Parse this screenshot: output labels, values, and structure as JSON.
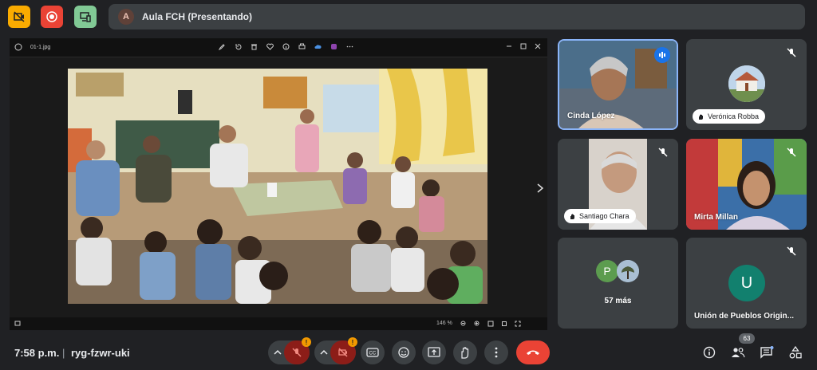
{
  "header": {
    "presenter_initial": "A",
    "presenter_label": "Aula FCH (Presentando)",
    "colors": {
      "no_camera": "#f9ab00",
      "record": "#ea4335",
      "devices": "#81c995"
    },
    "icons": [
      "camera-off-icon",
      "record-icon",
      "cast-devices-icon"
    ]
  },
  "share": {
    "file_name": "01-1.jpg",
    "zoom_value": "146 %",
    "icons": [
      "edit-icon",
      "rotate-icon",
      "delete-icon",
      "heart-icon",
      "info-icon",
      "print-icon",
      "cloud-icon",
      "app-icon",
      "more-icon"
    ]
  },
  "participants": [
    {
      "name": "Cinda López",
      "speaking": true
    },
    {
      "name": "Verónica Robba",
      "muted": true
    },
    {
      "name": "Santiago Chara",
      "muted": true
    },
    {
      "name": "Mirta Millan",
      "muted": true
    },
    {
      "name": "57 más",
      "initial": "P"
    },
    {
      "name": "Unión de Pueblos Origin...",
      "initial": "U",
      "muted": true
    }
  ],
  "footer": {
    "time": "7:58 p.m.",
    "separator": "|",
    "meeting_code": "ryg-fzwr-uki",
    "mic_badge": "!",
    "cam_badge": "!",
    "participants_count": "63"
  }
}
